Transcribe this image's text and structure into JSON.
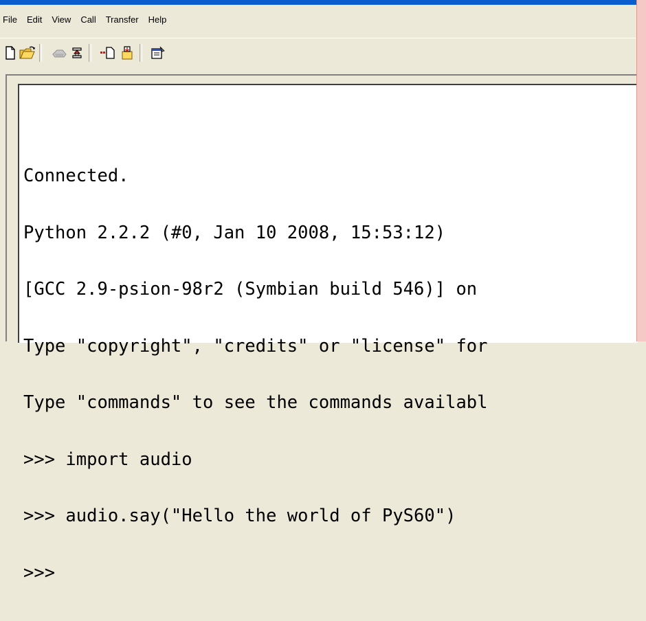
{
  "menu": {
    "items": [
      "File",
      "Edit",
      "View",
      "Call",
      "Transfer",
      "Help"
    ]
  },
  "toolbar": {
    "buttons": [
      {
        "icon": "new-document-icon"
      },
      {
        "icon": "open-folder-icon"
      },
      {
        "icon": "dial-phone-icon"
      },
      {
        "icon": "disconnect-icon"
      },
      {
        "icon": "send-file-icon"
      },
      {
        "icon": "receive-file-icon"
      },
      {
        "icon": "properties-icon"
      }
    ]
  },
  "terminal": {
    "lines": [
      "Connected.",
      "Python 2.2.2 (#0, Jan 10 2008, 15:53:12)",
      "[GCC 2.9-psion-98r2 (Symbian build 546)] on",
      "Type \"copyright\", \"credits\" or \"license\" for",
      "Type \"commands\" to see the commands availabl",
      ">>> import audio",
      ">>> audio.say(\"Hello the world of PyS60\")",
      ">>>"
    ]
  },
  "colors": {
    "chrome": "#ece9d8",
    "titlebar_blue": "#0a5ccf",
    "right_strip": "#f4c9c6"
  }
}
